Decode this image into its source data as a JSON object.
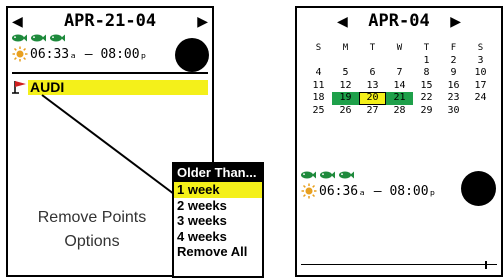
{
  "left": {
    "title": "APR-21-04",
    "sun_times": "06:33ₐ – 08:00ₚ",
    "waypoint": "AUDI",
    "caption_line1": "Remove Points",
    "caption_line2": "Options",
    "popup": {
      "title": "Older Than...",
      "items": [
        "1 week",
        "2 weeks",
        "3 weeks",
        "4 weeks",
        "Remove All"
      ],
      "selected_index": 0
    }
  },
  "right": {
    "title": "APR-04",
    "sun_times": "06:36ₐ – 08:00ₚ",
    "calendar": {
      "weekdays": [
        "S",
        "M",
        "T",
        "W",
        "T",
        "F",
        "S"
      ],
      "weeks": [
        [
          "",
          "",
          "",
          "",
          "1",
          "2",
          "3"
        ],
        [
          "4",
          "5",
          "6",
          "7",
          "8",
          "9",
          "10"
        ],
        [
          "11",
          "12",
          "13",
          "14",
          "15",
          "16",
          "17"
        ],
        [
          "18",
          "19",
          "20",
          "21",
          "22",
          "23",
          "24"
        ],
        [
          "25",
          "26",
          "27",
          "28",
          "29",
          "30",
          ""
        ]
      ],
      "highlight_green": [
        "19",
        "21"
      ],
      "highlight_selected": "20"
    }
  },
  "colors": {
    "highlight_yellow": "#f4f01a",
    "highlight_green": "#1ea04a",
    "fish_green": "#1e8a3c",
    "sun_orange": "#e8a020"
  },
  "icons": {
    "arrows": [
      "left-arrow-icon",
      "right-arrow-icon"
    ],
    "fish": "fish-icon",
    "sun": "sun-icon",
    "moon": "moon-phase-icon",
    "waypoint": "waypoint-flag-icon"
  }
}
